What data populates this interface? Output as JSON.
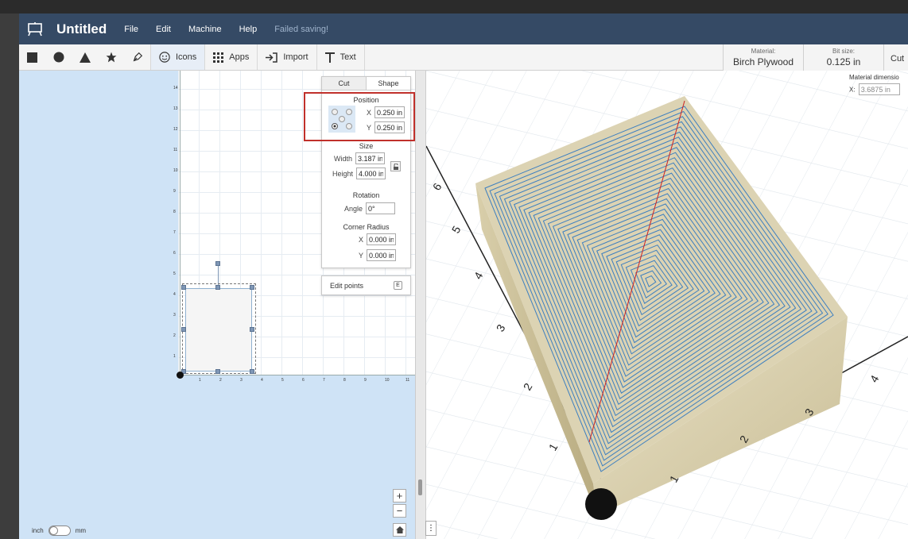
{
  "app": {
    "title": "Untitled",
    "status": "Failed saving!",
    "menu": [
      "File",
      "Edit",
      "Machine",
      "Help"
    ]
  },
  "toolbar": {
    "icons_label": "Icons",
    "apps_label": "Apps",
    "import_label": "Import",
    "text_label": "Text",
    "material_label": "Material:",
    "material_value": "Birch Plywood",
    "bit_label": "Bit size:",
    "bit_value": "0.125 in",
    "cut_label": "Cut"
  },
  "panel": {
    "tab_cut": "Cut",
    "tab_shape": "Shape",
    "position_title": "Position",
    "x_label": "X",
    "x_value": "0.250 in",
    "y_label": "Y",
    "y_value": "0.250 in",
    "size_title": "Size",
    "width_label": "Width",
    "width_value": "3.187 in",
    "height_label": "Height",
    "height_value": "4.000 in",
    "rotation_title": "Rotation",
    "angle_label": "Angle",
    "angle_value": "0°",
    "corner_title": "Corner Radius",
    "cx_label": "X",
    "cx_value": "0.000 in",
    "cy_label": "Y",
    "cy_value": "0.000 in"
  },
  "edit_points": {
    "label": "Edit points",
    "key": "E"
  },
  "units": {
    "left": "inch",
    "right": "mm"
  },
  "canvas2d": {
    "y_ticks": [
      "14",
      "13",
      "12",
      "11",
      "10",
      "9",
      "8",
      "7",
      "6",
      "5",
      "4",
      "3",
      "2",
      "1"
    ],
    "x_ticks": [
      "1",
      "2",
      "3",
      "4",
      "5",
      "6",
      "7",
      "8",
      "9",
      "10",
      "11"
    ]
  },
  "view3d": {
    "matdim_label": "Material dimensio",
    "matdim_x_label": "X:",
    "matdim_x_value": "3.6875 in",
    "axis_left_labels": [
      "6",
      "5",
      "4",
      "3",
      "2",
      "1"
    ],
    "axis_bottom_labels": [
      "1",
      "2",
      "3",
      "4"
    ]
  },
  "colors": {
    "topbar": "#354a65",
    "canvas_bg": "#cfe3f6",
    "toolpath": "#3d7fc0",
    "material": "#d9d0b0",
    "highlight": "#c0302b"
  }
}
